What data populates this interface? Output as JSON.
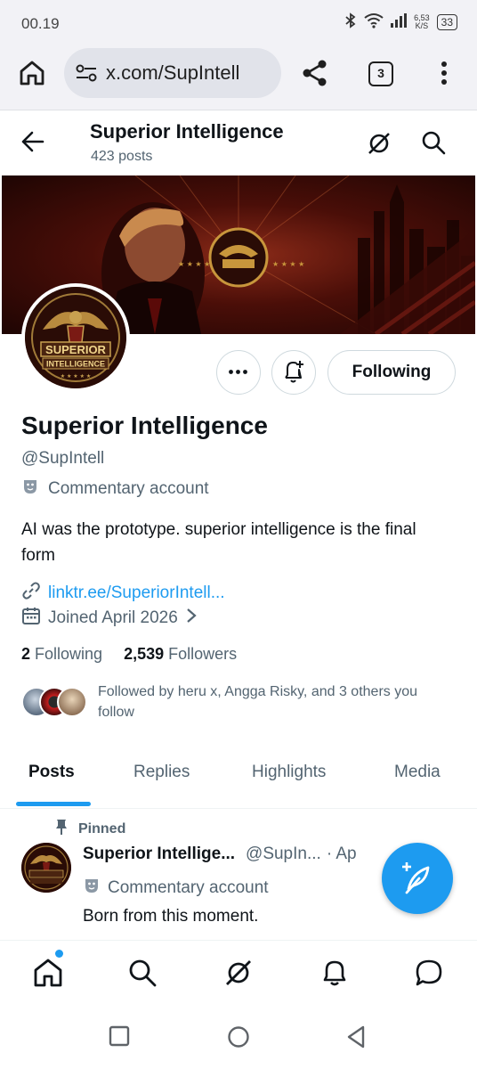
{
  "status_bar": {
    "time": "00.19",
    "speed_value": "6,53",
    "speed_unit": "K/S",
    "battery": "33"
  },
  "browser": {
    "url": "x.com/SupIntell",
    "tab_count": "3"
  },
  "profile_header": {
    "name": "Superior Intelligence",
    "post_count": "423 posts"
  },
  "avatar": {
    "line1": "SUPERIOR",
    "line2": "INTELLIGENCE"
  },
  "actions": {
    "following_label": "Following"
  },
  "profile": {
    "display_name": "Superior Intelligence",
    "handle": "@SupIntell",
    "label": "Commentary account",
    "bio": "AI was the prototype. superior intelligence is the final form",
    "link": "linktr.ee/SuperiorIntell...",
    "joined": "Joined April 2026",
    "following_count": "2",
    "following_label": "Following",
    "followers_count": "2,539",
    "followers_label": "Followers",
    "followed_by": "Followed by heru x, Angga Risky, and 3 others you follow"
  },
  "tabs": [
    "Posts",
    "Replies",
    "Highlights",
    "Media"
  ],
  "pinned_post": {
    "pinned_label": "Pinned",
    "author": "Superior Intellige...",
    "handle": "@SupIn...",
    "date": "· Ap",
    "label": "Commentary account",
    "text": "Born from this moment."
  },
  "colors": {
    "accent": "#1d9bf0",
    "secondary_text": "#536471",
    "banner": "#5a1208"
  }
}
